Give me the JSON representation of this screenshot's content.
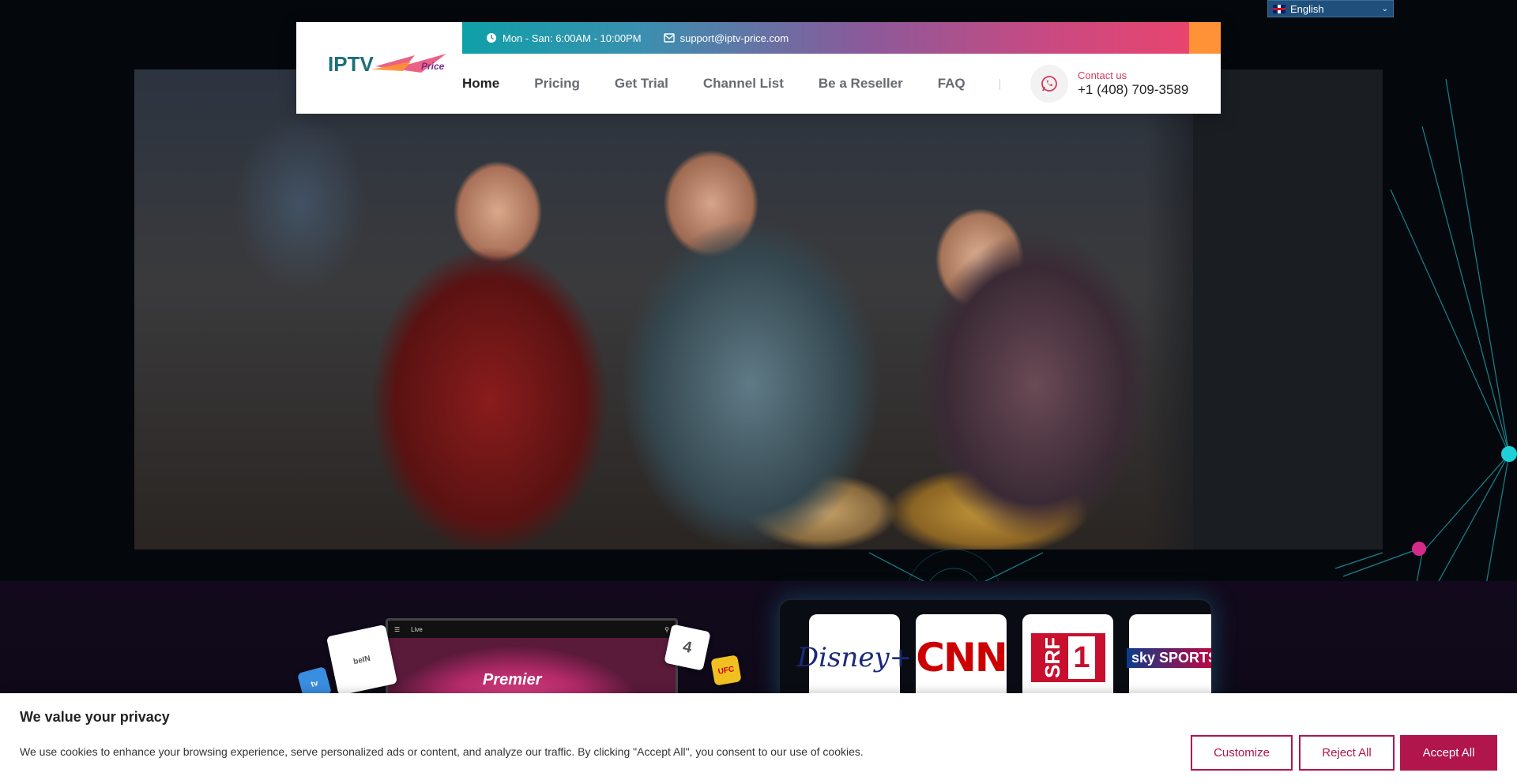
{
  "language": {
    "selected": "English"
  },
  "header": {
    "hours": "Mon - San: 6:00AM - 10:00PM",
    "email": "support@iptv-price.com",
    "logo_text": "IPTV",
    "logo_sub": "Price",
    "nav": [
      {
        "label": "Home",
        "active": true
      },
      {
        "label": "Pricing"
      },
      {
        "label": "Get Trial"
      },
      {
        "label": "Channel List"
      },
      {
        "label": "Be a Reseller"
      },
      {
        "label": "FAQ"
      }
    ],
    "contact_label": "Contact us",
    "contact_phone": "+1 (408) 709-3589"
  },
  "device": {
    "bar_label": "Live",
    "screen_text": "Premier"
  },
  "cubes": [
    "beIN",
    "tv",
    "4",
    "UFC"
  ],
  "channels": {
    "disney": "Disney+",
    "cnn": "CNN",
    "srf": "SRF",
    "srf_num": "1",
    "sky": "sky SPORTS"
  },
  "cookie": {
    "title": "We value your privacy",
    "text": "We use cookies to enhance your browsing experience, serve personalized ads or content, and analyze our traffic. By clicking \"Accept All\", you consent to our use of cookies.",
    "customize": "Customize",
    "reject": "Reject All",
    "accept": "Accept All"
  },
  "colors": {
    "accent": "#b0154b",
    "topbar_start": "#0fa0a8",
    "topbar_end": "#e8456f",
    "orange": "#ff9236"
  }
}
